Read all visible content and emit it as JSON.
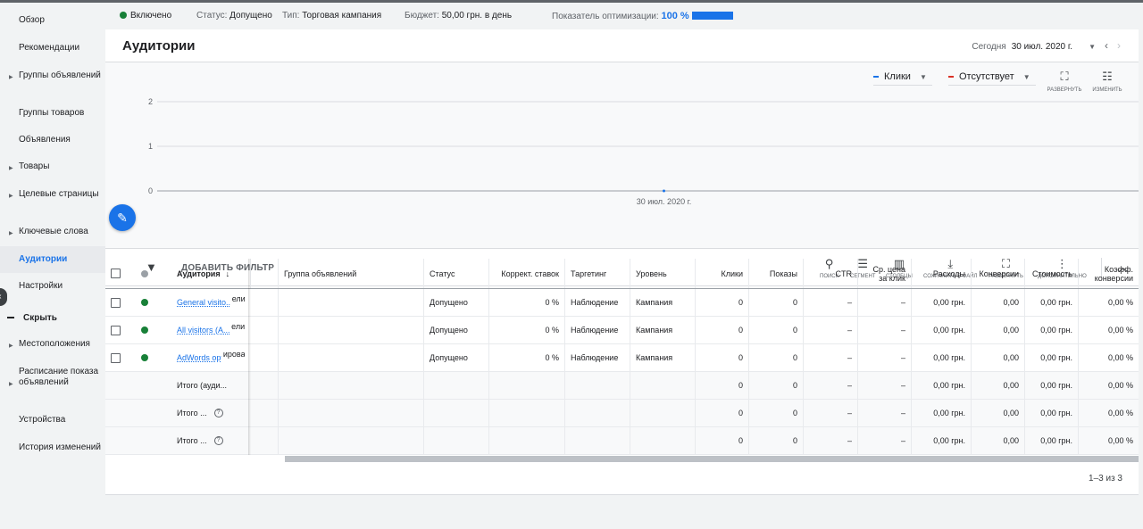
{
  "sidebar": {
    "items": [
      {
        "label": "Обзор",
        "arrow": false
      },
      {
        "label": "Рекомендации",
        "arrow": false
      },
      {
        "label": "Группы объявлений",
        "arrow": true
      },
      {
        "label": "Группы товаров",
        "arrow": false
      },
      {
        "label": "Объявления",
        "arrow": false
      },
      {
        "label": "Товары",
        "arrow": true
      },
      {
        "label": "Целевые страницы",
        "arrow": true
      },
      {
        "label": "Ключевые слова",
        "arrow": true
      },
      {
        "label": "Аудитории",
        "arrow": false,
        "active": true
      },
      {
        "label": "Настройки",
        "arrow": false
      }
    ],
    "hide_label": "Скрыть",
    "more_items": [
      {
        "label": "Местоположения",
        "arrow": true
      },
      {
        "label": "Расписание показа объявлений",
        "arrow": true
      },
      {
        "label": "Устройства",
        "arrow": false
      },
      {
        "label": "История изменений",
        "arrow": false
      }
    ]
  },
  "status": {
    "enabled": "Включено",
    "status_label": "Статус:",
    "status_value": "Допущено",
    "type_label": "Тип:",
    "type_value": "Торговая кампания",
    "budget_label": "Бюджет:",
    "budget_value": "50,00 грн. в день",
    "opt_label": "Показатель оптимизации:",
    "opt_value": "100 %",
    "opt_percent": 100
  },
  "header": {
    "title": "Аудитории",
    "today": "Сегодня",
    "date": "30 июл. 2020 г."
  },
  "chart_controls": {
    "metric1": "Клики",
    "metric2": "Отсутствует",
    "expand": "РАЗВЕРНУТЬ",
    "edit": "ИЗМЕНИТЬ"
  },
  "chart_data": {
    "type": "line",
    "x": [
      "30 июл. 2020 г."
    ],
    "series": [
      {
        "name": "Клики",
        "values": [
          0
        ]
      }
    ],
    "y_ticks": [
      "0",
      "1",
      "2"
    ],
    "ylim": [
      0,
      2
    ],
    "color": "#1a73e8"
  },
  "toolbar": {
    "add_filter": "ДОБАВИТЬ ФИЛЬТР",
    "search": "ПОИСК",
    "segment": "СЕГМЕНТ",
    "columns": "СТОЛБЦЫ",
    "save": "СОХРАНИТЬ В ФАЙЛ",
    "expand": "РАЗВЕРНУТЬ",
    "more": "ДОПОЛНИТЕЛЬНО"
  },
  "table": {
    "headers": {
      "audience": "Аудитория",
      "adgroup": "Группа объявлений",
      "status": "Статус",
      "bid": "Коррект. ставок",
      "targeting": "Таргетинг",
      "level": "Уровень",
      "clicks": "Клики",
      "impr": "Показы",
      "ctr": "CTR",
      "cpc": "Ср. цена за клик",
      "cost": "Расходы",
      "conv": "Конверсии",
      "cost_conv": "Стоимость",
      "conv_rate": "Коэфф. конверсии"
    },
    "rows": [
      {
        "audience": "General visito...",
        "overflow": "ели",
        "status": "Допущено",
        "bid": "0 %",
        "targeting": "Наблюдение",
        "level": "Кампания",
        "clicks": "0",
        "impr": "0",
        "ctr": "–",
        "cpc": "–",
        "cost": "0,00 грн.",
        "conv": "0,00",
        "cost_conv": "0,00 грн.",
        "conv_rate": "0,00 %"
      },
      {
        "audience": "All visitors (A...",
        "overflow": "ели",
        "status": "Допущено",
        "bid": "0 %",
        "targeting": "Наблюдение",
        "level": "Кампания",
        "clicks": "0",
        "impr": "0",
        "ctr": "–",
        "cpc": "–",
        "cost": "0,00 грн.",
        "conv": "0,00",
        "cost_conv": "0,00 грн.",
        "conv_rate": "0,00 %"
      },
      {
        "audience": "AdWords opti...",
        "overflow": "ирован",
        "status": "Допущено",
        "bid": "0 %",
        "targeting": "Наблюдение",
        "level": "Кампания",
        "clicks": "0",
        "impr": "0",
        "ctr": "–",
        "cpc": "–",
        "cost": "0,00 грн.",
        "conv": "0,00",
        "cost_conv": "0,00 грн.",
        "conv_rate": "0,00 %"
      }
    ],
    "totals": [
      {
        "label": "Итого (ауди...",
        "clicks": "0",
        "impr": "0",
        "ctr": "–",
        "cpc": "–",
        "cost": "0,00 грн.",
        "conv": "0,00",
        "cost_conv": "0,00 грн.",
        "conv_rate": "0,00 %"
      },
      {
        "label": "Итого ...",
        "help": "?",
        "clicks": "0",
        "impr": "0",
        "ctr": "–",
        "cpc": "–",
        "cost": "0,00 грн.",
        "conv": "0,00",
        "cost_conv": "0,00 грн.",
        "conv_rate": "0,00 %"
      },
      {
        "label": "Итого ...",
        "help": "?",
        "clicks": "0",
        "impr": "0",
        "ctr": "–",
        "cpc": "–",
        "cost": "0,00 грн.",
        "conv": "0,00",
        "cost_conv": "0,00 грн.",
        "conv_rate": "0,00 %"
      }
    ],
    "pager": "1–3 из 3"
  }
}
